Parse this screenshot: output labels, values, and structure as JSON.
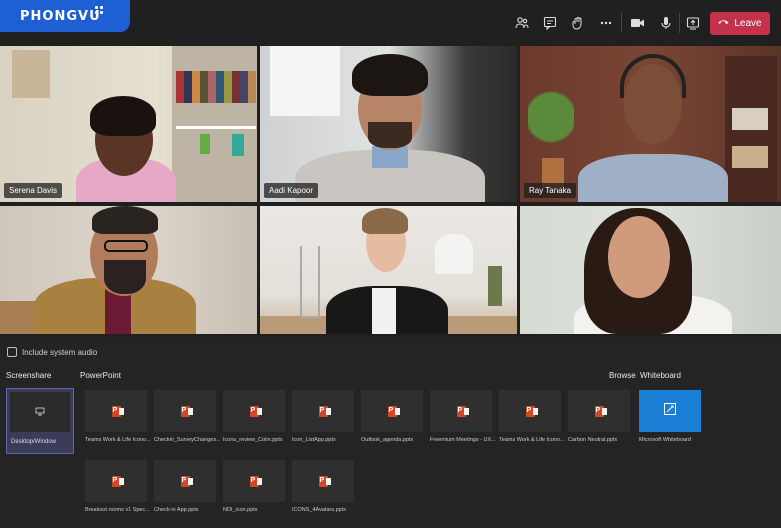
{
  "brand": {
    "logo_text": "PHONGVU"
  },
  "toolbar": {
    "leave_label": "Leave",
    "icons": [
      "people-icon",
      "chat-icon",
      "raise-hand-icon",
      "more-icon",
      "camera-icon",
      "mic-icon",
      "share-tray-icon",
      "phone-icon"
    ]
  },
  "participants": [
    {
      "name": "Serena Davis"
    },
    {
      "name": "Aadi Kapoor"
    },
    {
      "name": "Ray Tanaka"
    },
    {
      "name": ""
    },
    {
      "name": ""
    },
    {
      "name": ""
    }
  ],
  "share_tray": {
    "include_audio_label": "Include system audio",
    "screenshare_label": "Screenshare",
    "powerpoint_label": "PowerPoint",
    "browse_label": "Browse",
    "whiteboard_label": "Whiteboard",
    "desktop_label": "Desktop/Window",
    "whiteboard_item": "Microsoft Whiteboard",
    "files": [
      "Teams Work & Life Icono...",
      "Checkin_SurveyChanges...",
      "Icons_review_Colin.pptx",
      "Icon_ListApp.pptx",
      "Outlook_agenda.pptx",
      "Freemium Meetings - UX...",
      "Teams Work & Life Icono...",
      "Carbon Neutral.pptx",
      "Breakout rooms v1 Spec...",
      "Check-in App.pptx",
      "NDI_icon.pptx",
      "ICONS_4Avatars.pptx"
    ]
  },
  "colors": {
    "leave": "#c4314b",
    "accent": "#6264a7",
    "whiteboard": "#1a7fd4",
    "brand": "#1e5fd4"
  }
}
